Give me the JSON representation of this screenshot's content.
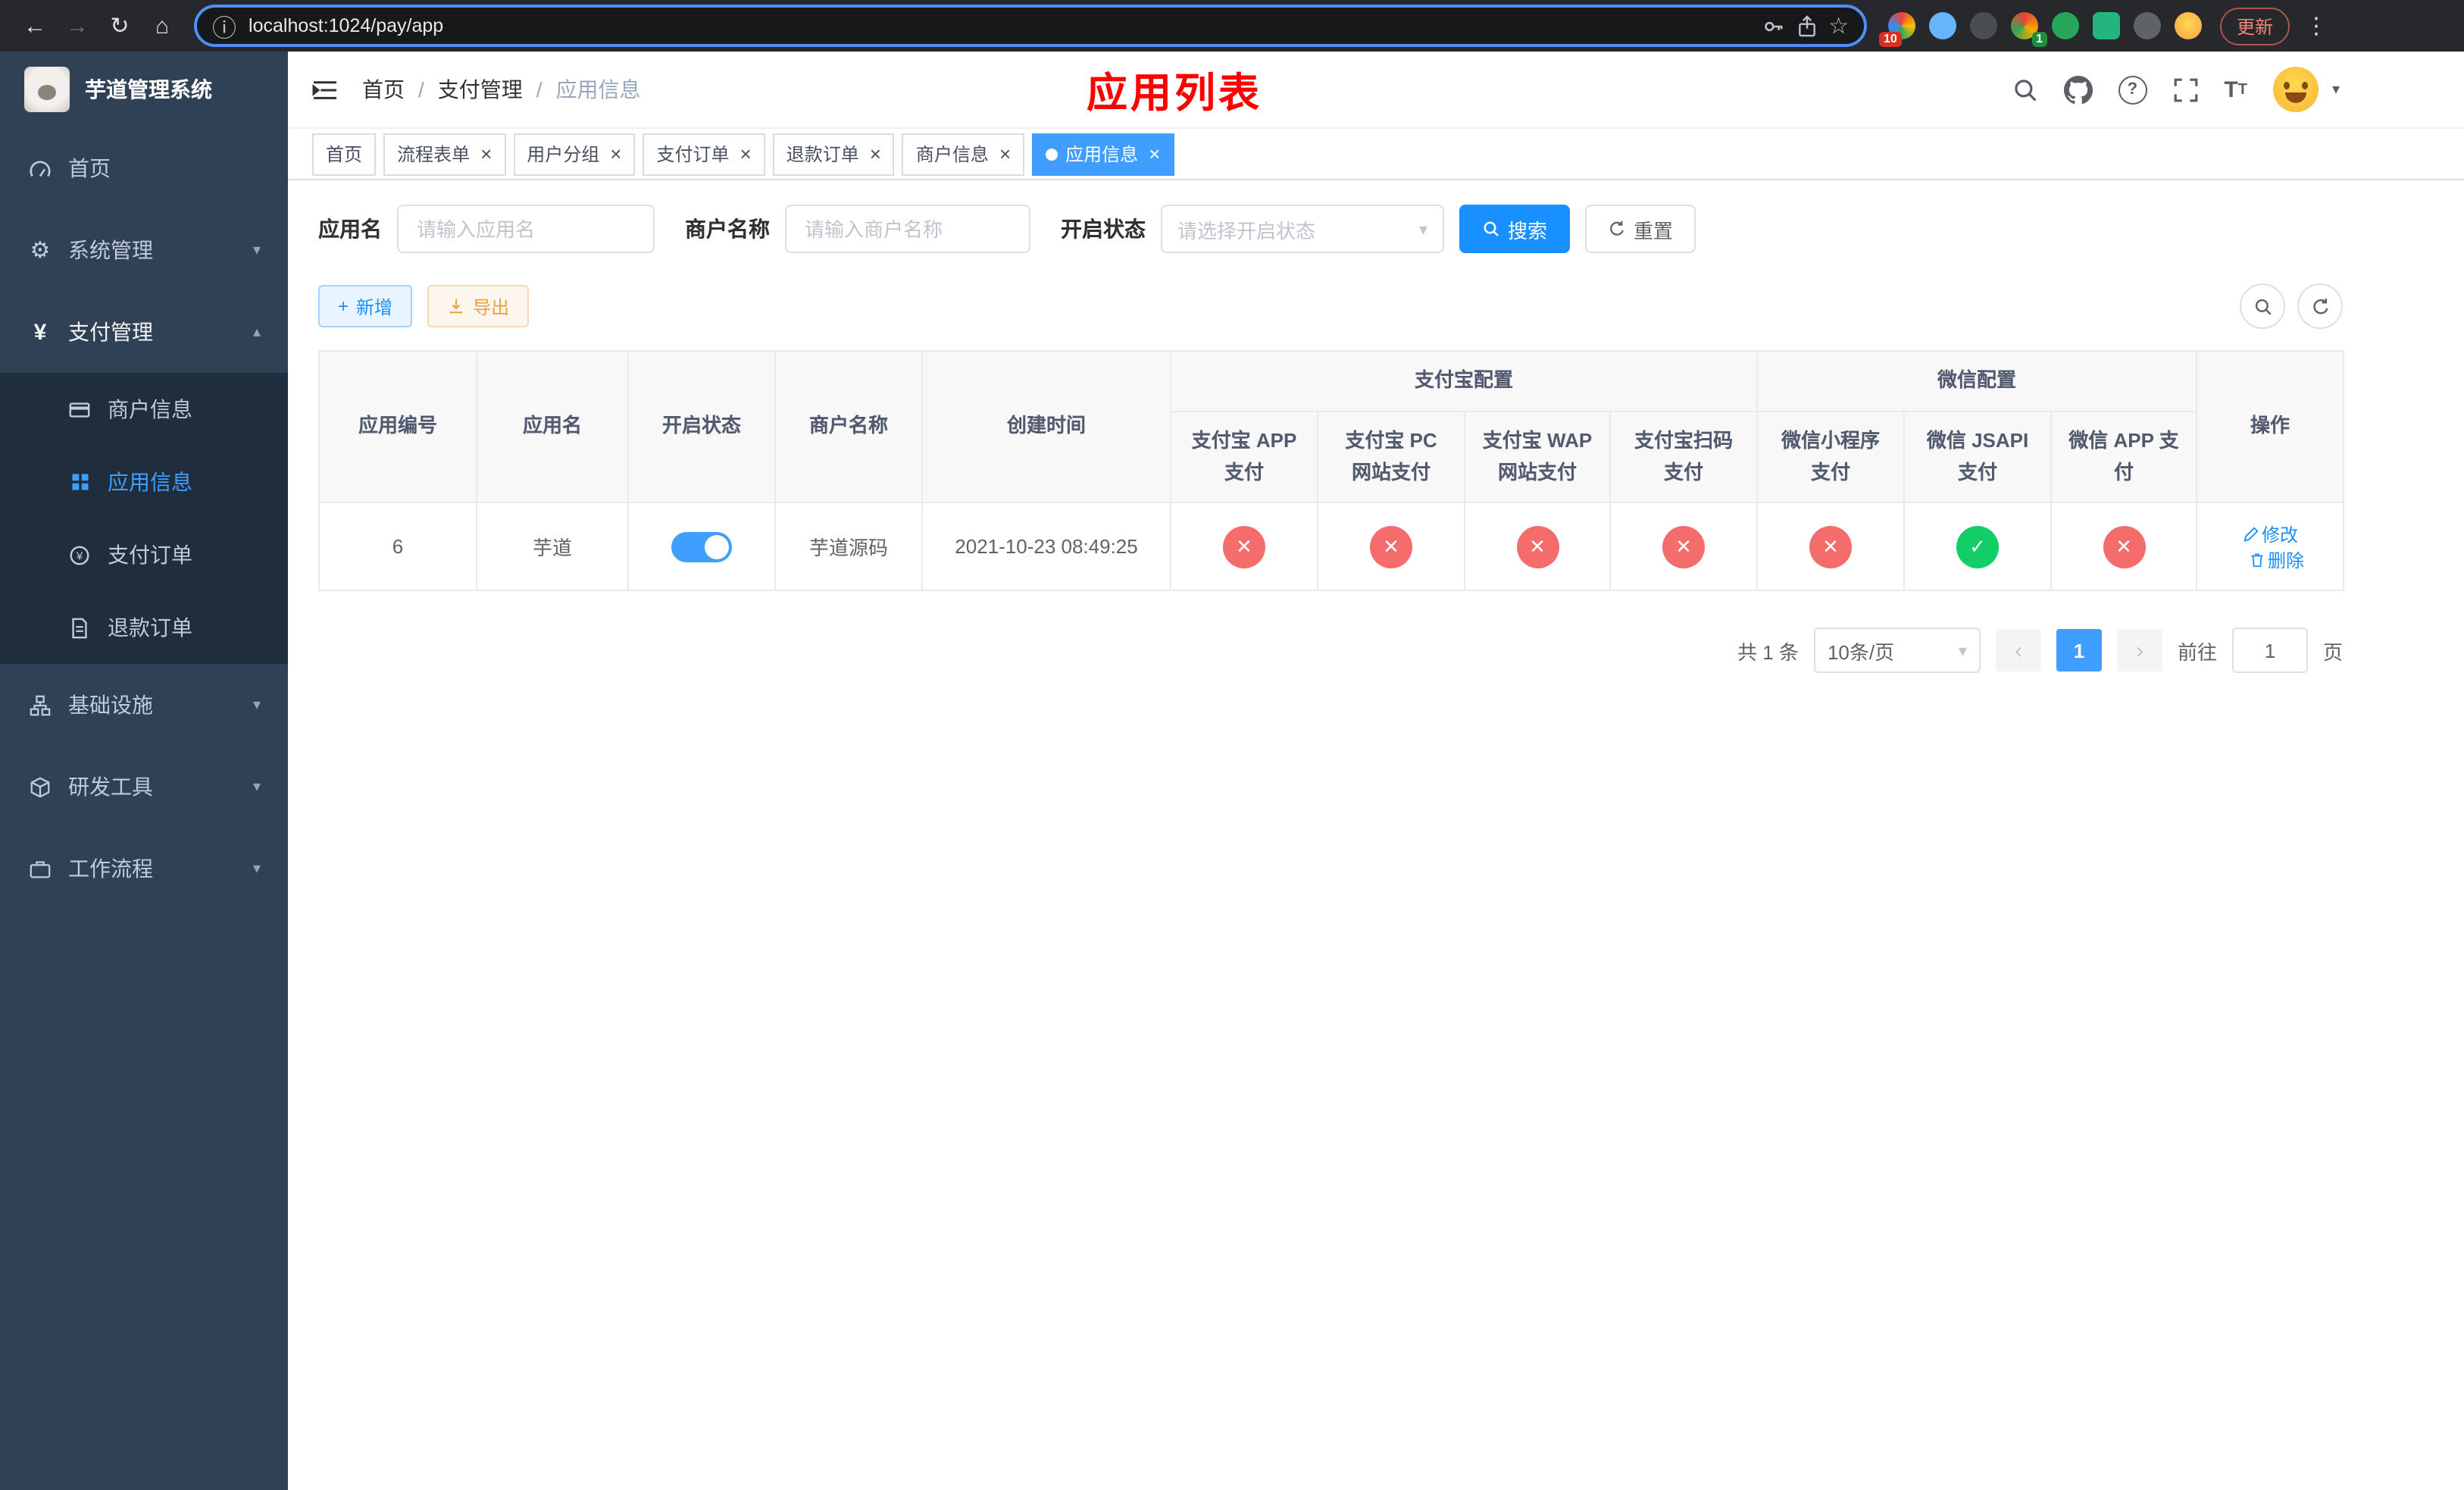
{
  "colors": {
    "accent": "#409eff",
    "search_blue": "#1890ff",
    "danger": "#f56c6c",
    "success": "#13ce66",
    "title_red": "#ff0000",
    "sidebar_bg": "#304156",
    "submenu_bg": "#1f2d3d"
  },
  "icons": {
    "cross": "✕",
    "check": "✓",
    "close": "×",
    "chevron_down": "▾",
    "chevron_up": "▴",
    "prev": "‹",
    "next": "›",
    "more": "⋮",
    "star": "☆",
    "back": "←",
    "forward": "→",
    "reload": "↻",
    "home": "⌂",
    "info": "ⓘ",
    "caret": "▾",
    "yen": "¥",
    "question": "?",
    "plus": "+"
  },
  "browser": {
    "url": "localhost:1024/pay/app",
    "update_label": "更新",
    "badge_10": "10",
    "badge_1": "1"
  },
  "sidebar": {
    "logo_title": "芋道管理系统",
    "items": [
      {
        "label": "首页"
      },
      {
        "label": "系统管理"
      },
      {
        "label": "支付管理",
        "children": [
          {
            "label": "商户信息"
          },
          {
            "label": "应用信息"
          },
          {
            "label": "支付订单"
          },
          {
            "label": "退款订单"
          }
        ]
      },
      {
        "label": "基础设施"
      },
      {
        "label": "研发工具"
      },
      {
        "label": "工作流程"
      }
    ]
  },
  "header": {
    "breadcrumb_1": "首页",
    "breadcrumb_2": "支付管理",
    "breadcrumb_3": "应用信息",
    "separator": "/",
    "title": "应用列表"
  },
  "tabs": [
    {
      "label": "首页"
    },
    {
      "label": "流程表单"
    },
    {
      "label": "用户分组"
    },
    {
      "label": "支付订单"
    },
    {
      "label": "退款订单"
    },
    {
      "label": "商户信息"
    },
    {
      "label": "应用信息"
    }
  ],
  "filters": {
    "app_name_label": "应用名",
    "app_name_placeholder": "请输入应用名",
    "merchant_label": "商户名称",
    "merchant_placeholder": "请输入商户名称",
    "status_label": "开启状态",
    "status_placeholder": "请选择开启状态",
    "search": "搜索",
    "reset": "重置"
  },
  "toolbar": {
    "add": "新增",
    "export": "导出"
  },
  "table": {
    "group_alipay": "支付宝配置",
    "group_wechat": "微信配置",
    "col_id": "应用编号",
    "col_name": "应用名",
    "col_status": "开启状态",
    "col_merchant": "商户名称",
    "col_created": "创建时间",
    "col_alipay_app": "支付宝 APP 支付",
    "col_alipay_pc": "支付宝 PC 网站支付",
    "col_alipay_wap": "支付宝 WAP 网站支付",
    "col_alipay_qr": "支付宝扫码支付",
    "col_wx_mini": "微信小程序支付",
    "col_wx_jsapi": "微信 JSAPI 支付",
    "col_wx_app": "微信 APP 支付",
    "col_action": "操作",
    "rows": [
      {
        "id": "6",
        "name": "芋道",
        "enabled": "on",
        "merchant": "芋道源码",
        "created": "2021-10-23 08:49:25",
        "alipay_app": "disabled",
        "alipay_pc": "disabled",
        "alipay_wap": "disabled",
        "alipay_qr": "disabled",
        "wx_mini": "disabled",
        "wx_jsapi": "enabled",
        "wx_app": "disabled",
        "edit": "修改",
        "delete": "删除"
      }
    ]
  },
  "pagination": {
    "total": "共 1 条",
    "page_size": "10条/页",
    "page": "1",
    "goto": "前往",
    "unit": "页",
    "goto_value": "1"
  }
}
